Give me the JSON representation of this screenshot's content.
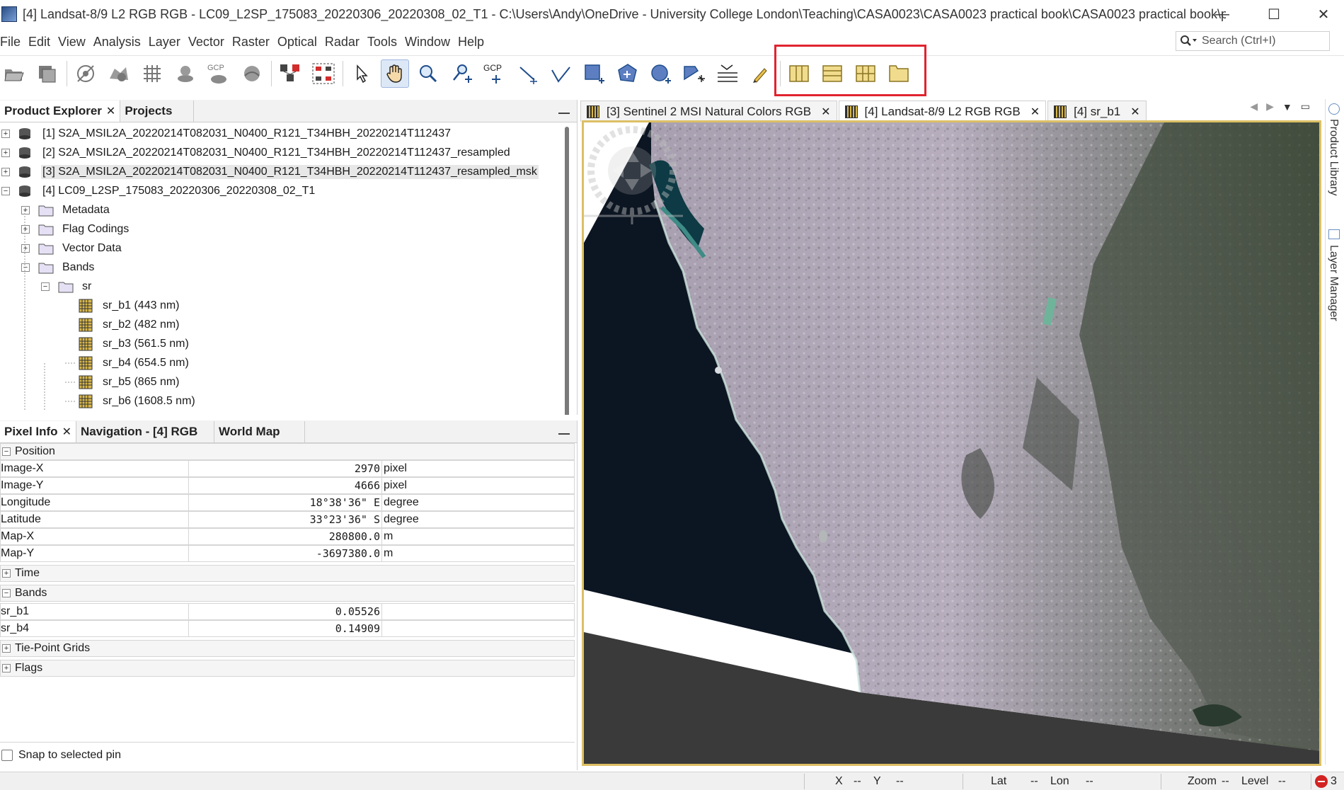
{
  "window": {
    "title": "[4] Landsat-8/9 L2 RGB RGB - LC09_L2SP_175083_20220306_20220308_02_T1 - C:\\Users\\Andy\\OneDrive - University College London\\Teaching\\CASA0023\\CASA0023 practical book\\CASA0023 practical book\\p...",
    "minimize": "—",
    "maximize": "☐",
    "close": "✕"
  },
  "menu": [
    "File",
    "Edit",
    "View",
    "Analysis",
    "Layer",
    "Vector",
    "Raster",
    "Optical",
    "Radar",
    "Tools",
    "Window",
    "Help"
  ],
  "search": {
    "placeholder": "Search (Ctrl+I)"
  },
  "toolbar": {
    "gcp_label_1": "GCP",
    "gcp_label_2": "GCP",
    "gcp_label_3": "GCP"
  },
  "product_explorer": {
    "tabs": [
      "Product Explorer",
      "Projects"
    ],
    "close": "✕",
    "tree": [
      {
        "label": "[1] S2A_MSIL2A_20220214T082031_N0400_R121_T34HBH_20220214T112437"
      },
      {
        "label": "[2] S2A_MSIL2A_20220214T082031_N0400_R121_T34HBH_20220214T112437_resampled"
      },
      {
        "label": "[3] S2A_MSIL2A_20220214T082031_N0400_R121_T34HBH_20220214T112437_resampled_msk"
      },
      {
        "label": "[4] LC09_L2SP_175083_20220306_20220308_02_T1"
      },
      {
        "label": "Metadata"
      },
      {
        "label": "Flag Codings"
      },
      {
        "label": "Vector Data"
      },
      {
        "label": "Bands"
      },
      {
        "label": "sr"
      },
      {
        "label": "sr_b1 (443 nm)"
      },
      {
        "label": "sr_b2 (482 nm)"
      },
      {
        "label": "sr_b3 (561.5 nm)"
      },
      {
        "label": "sr_b4 (654.5 nm)"
      },
      {
        "label": "sr_b5 (865 nm)"
      },
      {
        "label": "sr_b6 (1608.5 nm)"
      }
    ]
  },
  "pixel_info": {
    "tabs": [
      "Pixel Info",
      "Navigation - [4] RGB",
      "World Map"
    ],
    "close": "✕",
    "sections": {
      "position": "Position",
      "time": "Time",
      "bands": "Bands",
      "tie_point": "Tie-Point Grids",
      "flags": "Flags"
    },
    "position_rows": [
      {
        "name": "Image-X",
        "value": "2970",
        "unit": "pixel"
      },
      {
        "name": "Image-Y",
        "value": "4666",
        "unit": "pixel"
      },
      {
        "name": "Longitude",
        "value": "18°38'36\" E",
        "unit": "degree"
      },
      {
        "name": "Latitude",
        "value": "33°23'36\" S",
        "unit": "degree"
      },
      {
        "name": "Map-X",
        "value": "280800.0",
        "unit": "m"
      },
      {
        "name": "Map-Y",
        "value": "-3697380.0",
        "unit": "m"
      }
    ],
    "band_rows": [
      {
        "name": "sr_b1",
        "value": "0.05526",
        "unit": ""
      },
      {
        "name": "sr_b4",
        "value": "0.14909",
        "unit": ""
      }
    ],
    "snap_label": "Snap to selected pin"
  },
  "view_tabs": [
    {
      "label": "[3] Sentinel 2 MSI Natural Colors RGB",
      "close": "✕"
    },
    {
      "label": "[4] Landsat-8/9 L2 RGB RGB",
      "close": "✕"
    },
    {
      "label": "[4] sr_b1",
      "close": "✕"
    }
  ],
  "right_sidebar": {
    "product_library": "Product Library",
    "layer_manager": "Layer Manager"
  },
  "status": {
    "x_label": "X",
    "x_value": "--",
    "y_label": "Y",
    "y_value": "--",
    "lat_label": "Lat",
    "lat_value": "--",
    "lon_label": "Lon",
    "lon_value": "--",
    "zoom_label": "Zoom",
    "zoom_value": "--",
    "level_label": "Level",
    "level_value": "--",
    "error_count": "3"
  },
  "colors": {
    "highlight": "#e0232f",
    "view_border": "#dcc065"
  }
}
